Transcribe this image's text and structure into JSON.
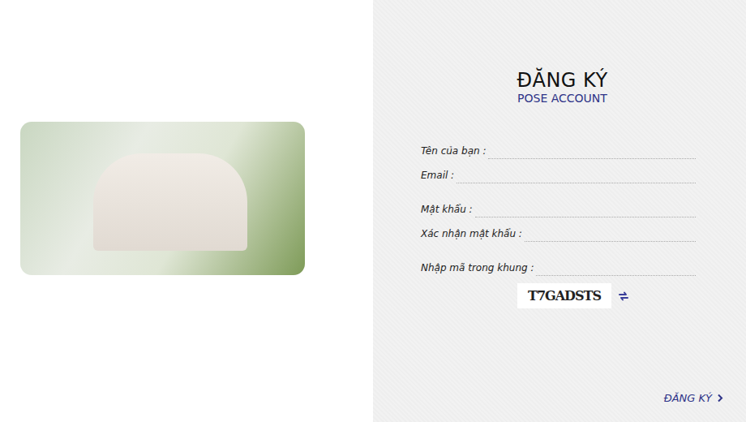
{
  "form": {
    "title": "ĐĂNG KÝ",
    "subtitle": "POSE ACCOUNT"
  },
  "fields": [
    {
      "label": "Tên của bạn :"
    },
    {
      "label": "Email :"
    },
    {
      "label": "Mật khẩu :"
    },
    {
      "label": "Xác nhận mật khẩu :"
    }
  ],
  "captcha": {
    "label": "Nhập mã trong khung :",
    "code": "T7GADSTS"
  },
  "submit": {
    "label": "ĐĂNG KÝ"
  }
}
